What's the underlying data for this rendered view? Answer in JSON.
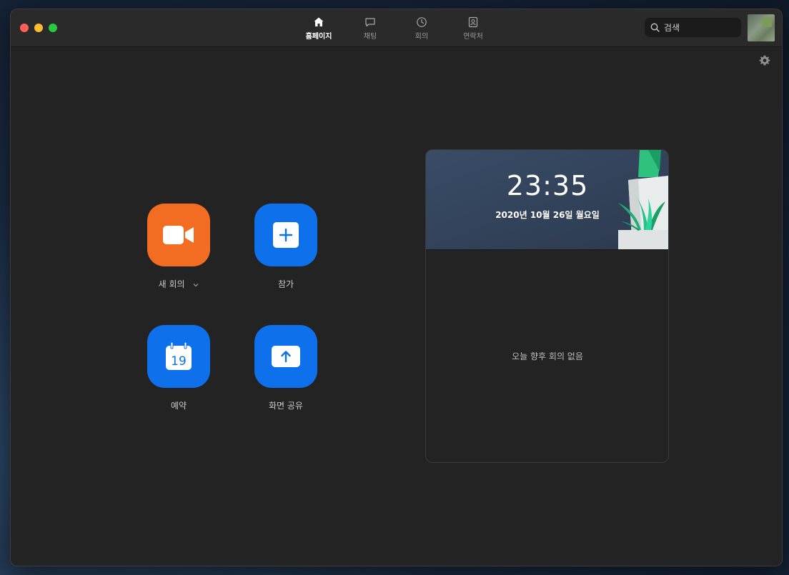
{
  "nav": {
    "tabs": [
      {
        "label": "홈페이지",
        "icon": "home-icon",
        "active": true
      },
      {
        "label": "채팅",
        "icon": "chat-icon",
        "active": false
      },
      {
        "label": "회의",
        "icon": "clock-icon",
        "active": false
      },
      {
        "label": "연락처",
        "icon": "contacts-icon",
        "active": false
      }
    ]
  },
  "search": {
    "placeholder": "검색"
  },
  "actions": {
    "new_meeting": {
      "label": "새 회의",
      "color": "#f26d21",
      "icon": "video-camera-icon"
    },
    "join": {
      "label": "참가",
      "color": "#0e71eb",
      "icon": "plus-icon"
    },
    "schedule": {
      "label": "예약",
      "color": "#0e71eb",
      "icon": "calendar-icon",
      "calendar_day": "19"
    },
    "share_screen": {
      "label": "화면 공유",
      "color": "#0e71eb",
      "icon": "share-up-arrow-icon"
    }
  },
  "meetings_card": {
    "time": "23:35",
    "date": "2020년 10월 26일 월요일",
    "empty_message": "오늘 향후 회의 없음"
  },
  "colors": {
    "window_bg": "#232323",
    "accent_blue": "#0e71eb",
    "accent_orange": "#f26d21"
  }
}
